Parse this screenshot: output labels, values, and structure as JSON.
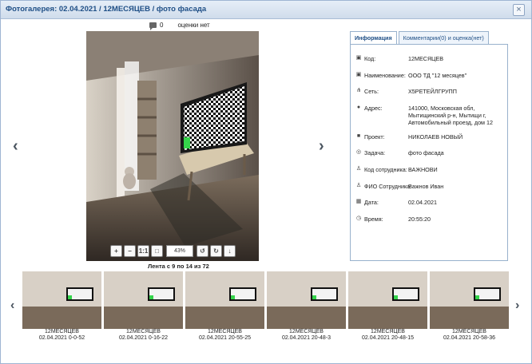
{
  "dialog": {
    "title": "Фотогалерея: 02.04.2021 / 12МЕСЯЦЕВ / фото фасада",
    "close_icon": "close-icon"
  },
  "photo_header": {
    "comment_count": "0",
    "rating_text": "оценки нет"
  },
  "viewer": {
    "zoom_value": "43%",
    "toolbar_icons": [
      "zoom-in-icon",
      "zoom-out-icon",
      "actual-size-icon",
      "fit-icon",
      "rotate-left-icon",
      "rotate-right-icon",
      "download-icon"
    ],
    "actual_size_label": "1:1",
    "strip_label": "Лента с 9 по 14 из 72"
  },
  "thumbnails": [
    {
      "title": "12МЕСЯЦЕВ",
      "date": "02.04.2021 0-0-52"
    },
    {
      "title": "12МЕСЯЦЕВ",
      "date": "02.04.2021 0-16-22"
    },
    {
      "title": "12МЕСЯЦЕВ",
      "date": "02.04.2021 20-55-25"
    },
    {
      "title": "12МЕСЯЦЕВ",
      "date": "02.04.2021 20-48-3"
    },
    {
      "title": "12МЕСЯЦЕВ",
      "date": "02.04.2021 20-48-15"
    },
    {
      "title": "12МЕСЯЦЕВ",
      "date": "02.04.2021 20-58-36"
    }
  ],
  "info_panel": {
    "tabs": [
      "Информация",
      "Комментарии(0) и оценка(нет)"
    ],
    "rows": [
      {
        "icon": "shop-icon",
        "label": "Код:",
        "value": "12МЕСЯЦЕВ"
      },
      {
        "icon": "shop-icon",
        "label": "Наименование:",
        "value": "ООО ТД \"12 месяцев\""
      },
      {
        "icon": "network-icon",
        "label": "Сеть:",
        "value": "Х5РЕТЕЙЛГРУПП"
      },
      {
        "icon": "location-icon",
        "label": "Адрес:",
        "value": "141000, Московская обл, Мытищинский р-н, Мытищи г, Автомобильный проезд, дом 12"
      },
      {
        "icon": "briefcase-icon",
        "label": "Проект:",
        "value": "НИКОЛАЕВ НОВЫЙ"
      },
      {
        "icon": "target-icon",
        "label": "Задача:",
        "value": "фото фасада"
      },
      {
        "icon": "user-icon",
        "label": "Код сотрудника:",
        "value": "ВАЖНОВИ"
      },
      {
        "icon": "user-icon",
        "label": "ФИО Сотрудника:",
        "value": "Важнов Иван"
      },
      {
        "icon": "calendar-icon",
        "label": "Дата:",
        "value": "02.04.2021"
      },
      {
        "icon": "clock-icon",
        "label": "Время:",
        "value": "20:55:20"
      }
    ]
  },
  "colors": {
    "title": "#1f4f86",
    "border": "#98b1cc"
  }
}
